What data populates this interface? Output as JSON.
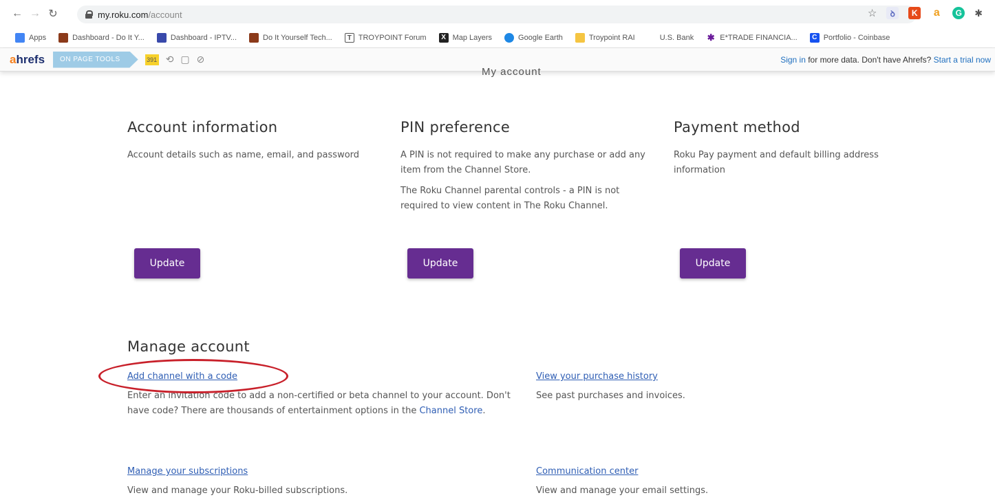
{
  "browser": {
    "url_host": "my.roku.com",
    "url_path": "/account",
    "bookmarks": [
      {
        "label": "Apps",
        "color": "#4285f4"
      },
      {
        "label": "Dashboard - Do It Y...",
        "color": "#8b3a1a"
      },
      {
        "label": "Dashboard - IPTV...",
        "color": "#3949ab"
      },
      {
        "label": "Do It Yourself Tech...",
        "color": "#8b3a1a"
      },
      {
        "label": "TROYPOINT Forum",
        "color": "#555555"
      },
      {
        "label": "Map Layers",
        "color": "#222222"
      },
      {
        "label": "Google Earth",
        "color": "#1e88e5"
      },
      {
        "label": "Troypoint RAI",
        "color": "#f5a623"
      },
      {
        "label": "U.S. Bank",
        "color": "#ffffff"
      },
      {
        "label": "E*TRADE FINANCIA...",
        "color": "#6a1b9a"
      },
      {
        "label": "Portfolio - Coinbase",
        "color": "#1652f0"
      }
    ]
  },
  "ahrefs": {
    "logo_a": "a",
    "logo_rest": "hrefs",
    "onpage_label": "ON PAGE TOOLS",
    "score": "391",
    "signin_link": "Sign in",
    "signin_text": " for more data. Don't have Ahrefs? ",
    "trial_link": "Start a trial now"
  },
  "page": {
    "cut_title": "My account"
  },
  "sections": {
    "account_info": {
      "title": "Account information",
      "desc": "Account details such as name, email, and password",
      "button": "Update"
    },
    "pin": {
      "title": "PIN preference",
      "desc1": "A PIN is not required to make any purchase or add any item from the Channel Store.",
      "desc2": "The Roku Channel parental controls - a PIN is not required to view content in The Roku Channel.",
      "button": "Update"
    },
    "payment": {
      "title": "Payment method",
      "desc": "Roku Pay payment and default billing address information",
      "button": "Update"
    }
  },
  "manage": {
    "title": "Manage account",
    "add_channel": {
      "link": "Add channel with a code",
      "desc_before": "Enter an invitation code to add a non-certified or beta channel to your account. Don't have code? There are thousands of entertainment options in the ",
      "desc_link": "Channel Store",
      "desc_after": "."
    },
    "purchase_history": {
      "link": "View your purchase history",
      "desc": "See past purchases and invoices."
    },
    "subscriptions": {
      "link": "Manage your subscriptions",
      "desc": "View and manage your Roku-billed subscriptions."
    },
    "communication": {
      "link": "Communication center",
      "desc": "View and manage your email settings."
    }
  },
  "colors": {
    "button_purple": "#662d91",
    "link_blue": "#2f5eb4",
    "annotation_red": "#c8202a"
  }
}
